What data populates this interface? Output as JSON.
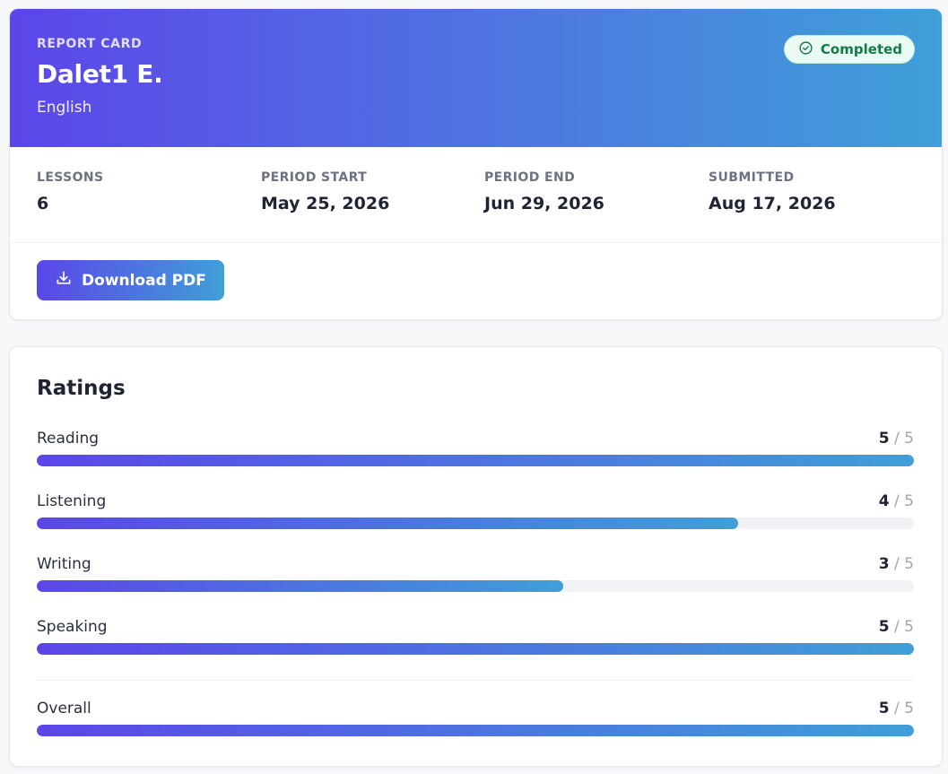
{
  "header": {
    "eyebrow": "REPORT CARD",
    "student_name": "Dalet1 E.",
    "subject": "English",
    "status_badge": "Completed"
  },
  "meta": [
    {
      "label": "LESSONS",
      "value": "6"
    },
    {
      "label": "PERIOD START",
      "value": "May 25, 2026"
    },
    {
      "label": "PERIOD END",
      "value": "Jun 29, 2026"
    },
    {
      "label": "SUBMITTED",
      "value": "Aug 17, 2026"
    }
  ],
  "actions": {
    "download_label": "Download PDF"
  },
  "ratings": {
    "title": "Ratings",
    "max_label": "5",
    "items": [
      {
        "name": "Reading",
        "score": "5",
        "fraction": 1.0
      },
      {
        "name": "Listening",
        "score": "4",
        "fraction": 0.8
      },
      {
        "name": "Writing",
        "score": "3",
        "fraction": 0.6
      },
      {
        "name": "Speaking",
        "score": "5",
        "fraction": 1.0
      }
    ],
    "overall": {
      "name": "Overall",
      "score": "5",
      "fraction": 1.0
    }
  },
  "colors": {
    "gradient_start": "#5b46e8",
    "gradient_end": "#3f9fd8",
    "badge_text": "#157a4b",
    "badge_bg": "#e9fbf2"
  }
}
